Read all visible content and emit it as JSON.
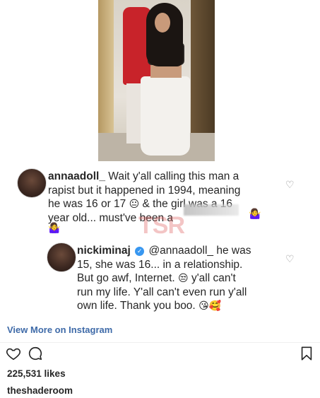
{
  "comments": [
    {
      "username": "annaadoll_",
      "line1": "Wait y'all calling this man a",
      "line2": "rapist but it happened in 1994, meaning",
      "line3a": "he was 16 or 17",
      "line3b": "& the girl was a 16",
      "line4": "year old... must've been a",
      "emoji_line3": "😐",
      "emoji_end": "🤷‍♀️"
    },
    {
      "username": "nickiminaj",
      "mention": "@annaadoll_",
      "line1b": "he was",
      "line2": "15, she was 16... in a relationship.",
      "line3a": "But go awf, Internet.",
      "line3b": "y'all can't",
      "line4": "run my life. Y'all can't even run y'all",
      "line5": "own life. Thank you boo.",
      "emoji_line3": "😒",
      "emoji_end": "😘🥰"
    }
  ],
  "watermark": "TSR",
  "view_more_label": "View More on Instagram",
  "likes_text": "225,531 likes",
  "owner_username": "theshaderoom",
  "icons": {
    "like": "heart-outline-icon",
    "comment": "comment-bubble-icon",
    "save": "bookmark-icon",
    "comment_like": "small-heart-icon",
    "verified": "verified-badge-icon"
  }
}
